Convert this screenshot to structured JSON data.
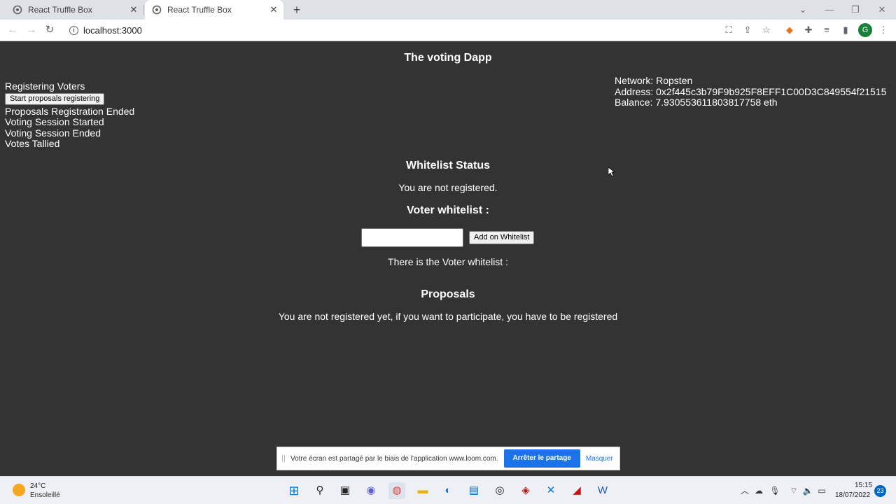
{
  "browser": {
    "tabs": [
      {
        "title": "React Truffle Box",
        "active": false
      },
      {
        "title": "React Truffle Box",
        "active": true
      }
    ],
    "url": "localhost:3000"
  },
  "app": {
    "title": "The voting Dapp",
    "workflow": {
      "step1": "Registering Voters",
      "start_button": "Start proposals registering",
      "step2": "Proposals Registration Ended",
      "step3": "Voting Session Started",
      "step4": "Voting Session Ended",
      "step5": "Votes Tallied"
    },
    "account": {
      "network": "Network: Ropsten",
      "address": "Address: 0x2f445c3b79F9b925F8EFF1C00D3C849554f21515",
      "balance": "Balance: 7.930553611803817758 eth"
    },
    "whitelist_status": {
      "title": "Whitelist Status",
      "message": "You are not registered."
    },
    "voter_whitelist": {
      "title": "Voter whitelist :",
      "input_value": "",
      "add_button": "Add on Whitelist",
      "list_label": "There is the Voter whitelist :"
    },
    "proposals": {
      "title": "Proposals",
      "message": "You are not registered yet, if you want to participate, you have to be registered"
    }
  },
  "loom_banner": {
    "message": "Votre écran est partagé par le biais de l'application www.loom.com.",
    "stop_button": "Arrêter le partage",
    "hide_link": "Masquer"
  },
  "taskbar": {
    "weather_temp": "24°C",
    "weather_desc": "Ensoleillé",
    "time": "15:15",
    "date": "18/07/2022",
    "notification_count": "23"
  }
}
